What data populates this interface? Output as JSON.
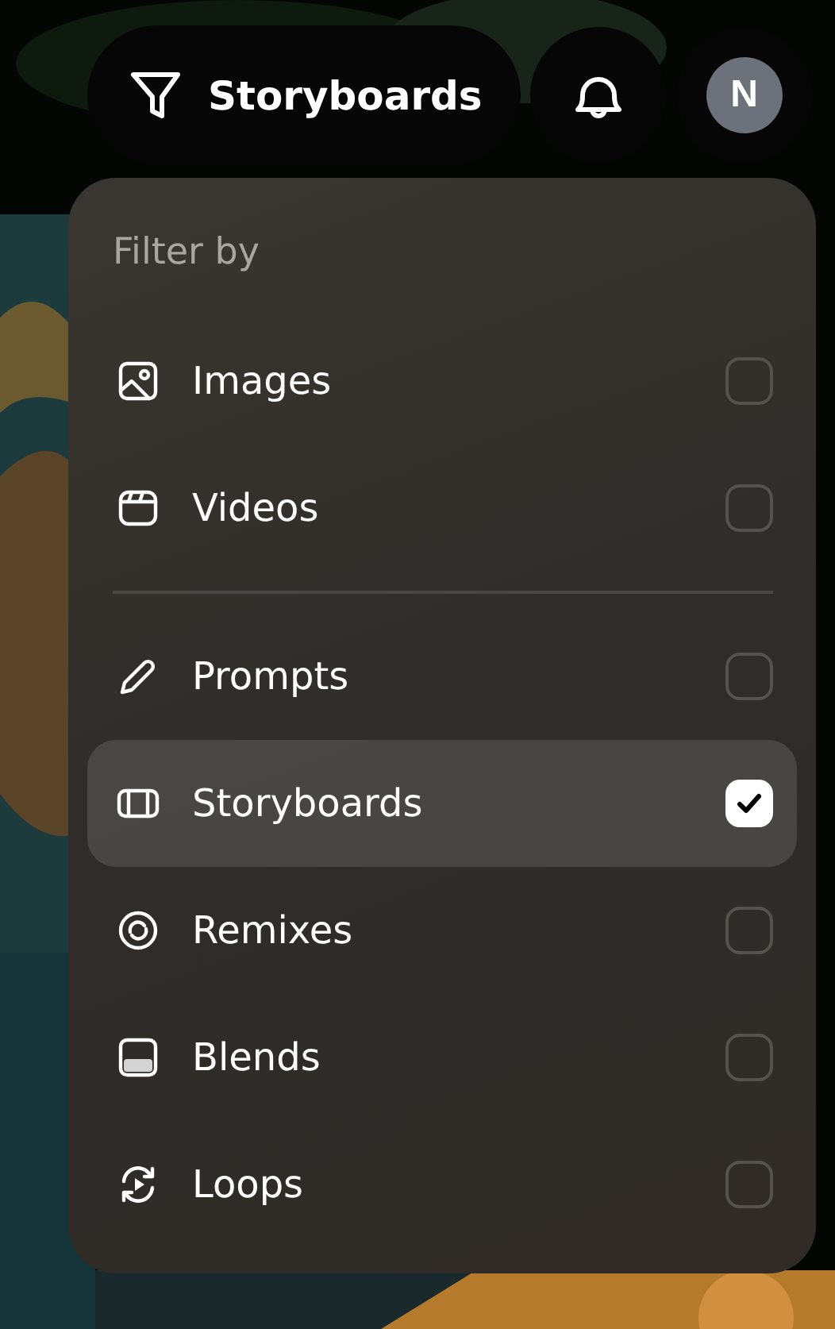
{
  "top_bar": {
    "filter_label": "Storyboards",
    "avatar_initial": "N"
  },
  "menu": {
    "heading": "Filter by",
    "groups": [
      [
        {
          "label": "Images",
          "checked": false,
          "selected": false
        },
        {
          "label": "Videos",
          "checked": false,
          "selected": false
        }
      ],
      [
        {
          "label": "Prompts",
          "checked": false,
          "selected": false
        },
        {
          "label": "Storyboards",
          "checked": true,
          "selected": true
        },
        {
          "label": "Remixes",
          "checked": false,
          "selected": false
        },
        {
          "label": "Blends",
          "checked": false,
          "selected": false
        },
        {
          "label": "Loops",
          "checked": false,
          "selected": false
        }
      ]
    ]
  }
}
